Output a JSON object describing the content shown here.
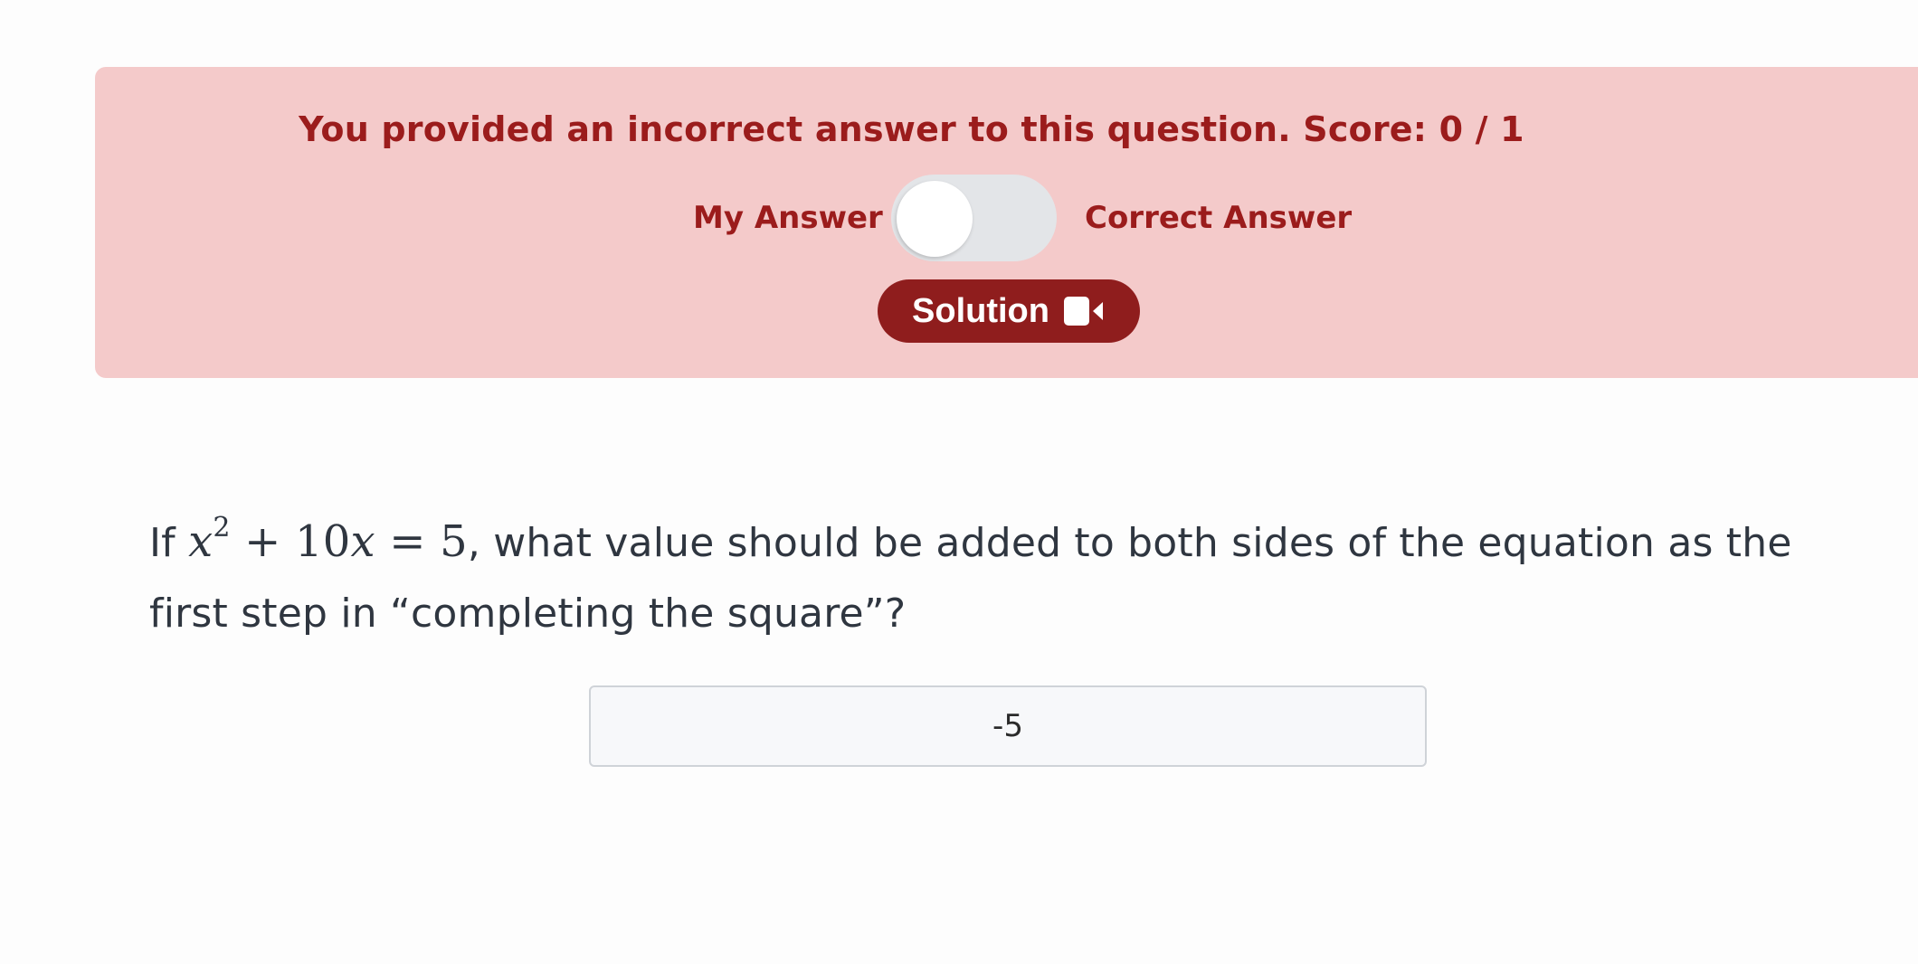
{
  "feedback": {
    "message": "You provided an incorrect answer to this question. Score: 0 / 1",
    "my_answer_label": "My Answer",
    "correct_answer_label": "Correct Answer",
    "toggle_state": "My Answer",
    "solution_button_label": "Solution",
    "solution_icon": "video-camera-icon",
    "banner_color": "#f4caca",
    "accent_color": "#8f1d1d"
  },
  "question": {
    "prefix": "If ",
    "math": {
      "x1": "x",
      "exp": "2",
      "plus": " + ",
      "coef": "10",
      "x2": "x",
      "equals": " = ",
      "rhs": "5"
    },
    "suffix": ", what value should be added to both sides of the equation as the first step in “completing the square”?"
  },
  "answer": {
    "value": "-5"
  }
}
